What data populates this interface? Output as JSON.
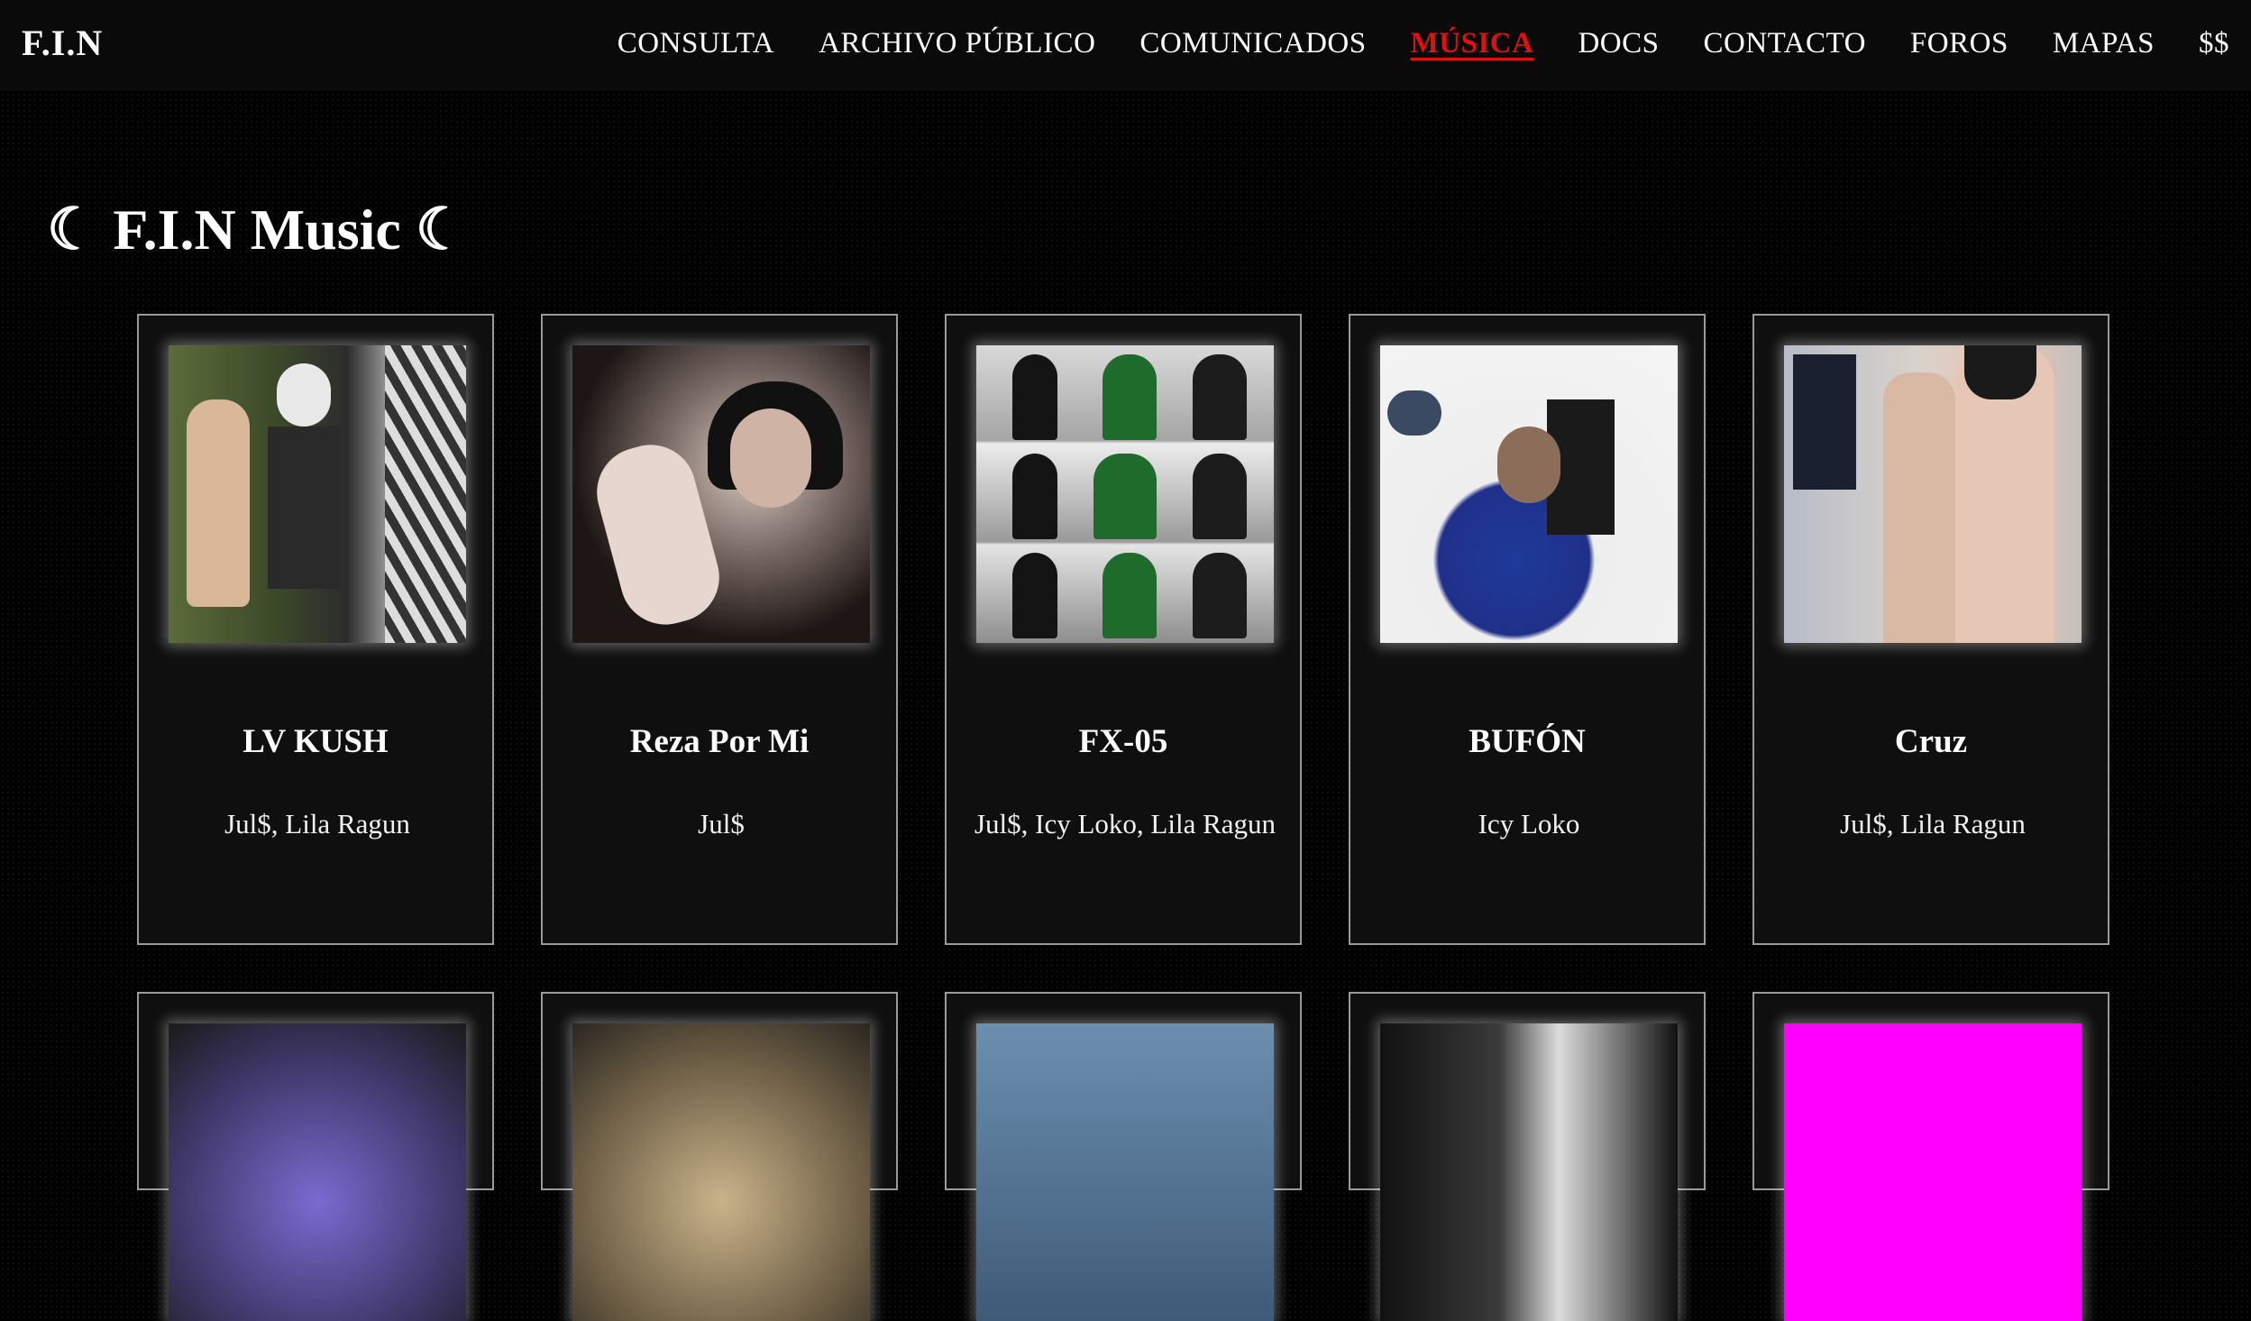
{
  "nav": {
    "logo": "F.I.N",
    "links": [
      "CONSULTA",
      "ARCHIVO PÚBLICO",
      "COMUNICADOS",
      "MÚSICA",
      "DOCS",
      "CONTACTO",
      "FOROS",
      "MAPAS",
      "$$"
    ],
    "active": "MÚSICA"
  },
  "page": {
    "title": "☾ F.I.N Music ☾"
  },
  "cards": [
    {
      "title": "LV KUSH",
      "artists": "Jul$, Lila Ragun"
    },
    {
      "title": "Reza Por Mi",
      "artists": "Jul$"
    },
    {
      "title": "FX-05",
      "artists": "Jul$, Icy Loko, Lila Ragun"
    },
    {
      "title": "BUFÓN",
      "artists": "Icy Loko"
    },
    {
      "title": "Cruz",
      "artists": "Jul$, Lila Ragun"
    }
  ],
  "colors": {
    "accent": "#e01010",
    "background": "#000000",
    "card_border": "#9a9a9a"
  }
}
